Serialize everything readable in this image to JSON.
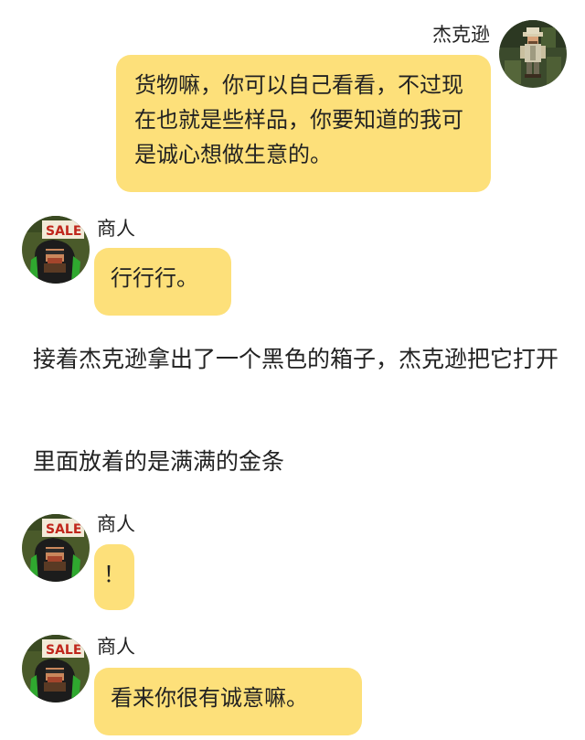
{
  "colors": {
    "bubble": "#fde07a",
    "text": "#222222",
    "background": "#ffffff"
  },
  "chat": [
    {
      "speaker": "杰克逊",
      "avatar": "jackson-avatar",
      "side": "right",
      "text": "货物嘛，你可以自己看看，不过现在也就是些样品，你要知道的我可是诚心想做生意的。"
    },
    {
      "speaker": "商人",
      "avatar": "merchant-avatar",
      "side": "left",
      "text": "行行行。"
    },
    {
      "narration": "接着杰克逊拿出了一个黑色的箱子，杰克逊把它打开"
    },
    {
      "narration": "里面放着的是满满的金条"
    },
    {
      "speaker": "商人",
      "avatar": "merchant-avatar",
      "side": "left",
      "text": "！"
    },
    {
      "speaker": "商人",
      "avatar": "merchant-avatar",
      "side": "left",
      "text": "看来你很有诚意嘛。"
    }
  ],
  "avatars": {
    "merchant_sign_text": "SALE"
  }
}
